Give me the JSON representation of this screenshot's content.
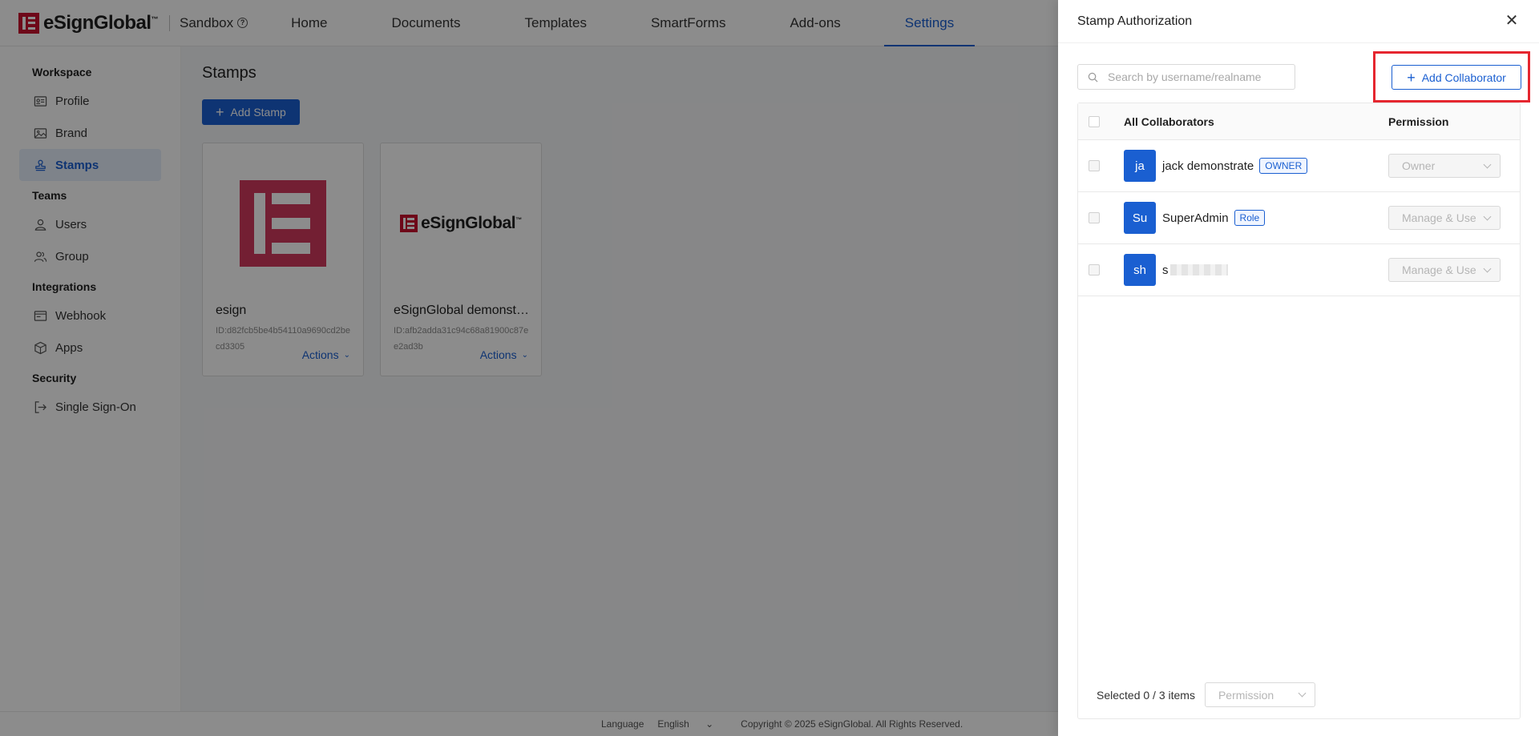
{
  "app": {
    "brand": "eSignGlobal",
    "trademark": "™",
    "environment": "Sandbox"
  },
  "nav": {
    "items": [
      {
        "label": "Home"
      },
      {
        "label": "Documents"
      },
      {
        "label": "Templates"
      },
      {
        "label": "SmartForms"
      },
      {
        "label": "Add-ons"
      },
      {
        "label": "Settings"
      }
    ],
    "active": "Settings"
  },
  "sidebar": {
    "workspace": "Workspace",
    "teams": "Teams",
    "integrations": "Integrations",
    "security": "Security",
    "items": {
      "profile": "Profile",
      "brand": "Brand",
      "stamps": "Stamps",
      "users": "Users",
      "group": "Group",
      "webhook": "Webhook",
      "apps": "Apps",
      "sso": "Single Sign-On"
    }
  },
  "main": {
    "title": "Stamps",
    "add_stamp": "Add Stamp",
    "cards": [
      {
        "name": "esign",
        "id": "ID:d82fcb5be4b54110a9690cd2becd3305",
        "actions": "Actions"
      },
      {
        "name": "eSignGlobal demonstrate",
        "id": "ID:afb2adda31c94c68a81900c87ee2ad3b",
        "actions": "Actions"
      }
    ]
  },
  "footer": {
    "language_label": "Language",
    "language_value": "English",
    "copyright": "Copyright © 2025 eSignGlobal. All Rights Reserved."
  },
  "drawer": {
    "title": "Stamp Authorization",
    "search_placeholder": "Search by username/realname",
    "add_collaborator": "Add Collaborator",
    "columns": {
      "name": "All Collaborators",
      "permission": "Permission"
    },
    "rows": [
      {
        "initials": "ja",
        "name": "jack demonstrate",
        "tag": "OWNER",
        "permission": "Owner"
      },
      {
        "initials": "Su",
        "name": "SuperAdmin",
        "tag": "Role",
        "permission": "Manage & Use"
      },
      {
        "initials": "sh",
        "name": "s",
        "tag": "",
        "permission": "Manage & Use"
      }
    ],
    "selected_text": "Selected 0 / 3 items",
    "bulk_permission": "Permission"
  },
  "colors": {
    "primary": "#1a5fd1",
    "brand_red": "#c8102e",
    "highlight": "#e5262f"
  }
}
